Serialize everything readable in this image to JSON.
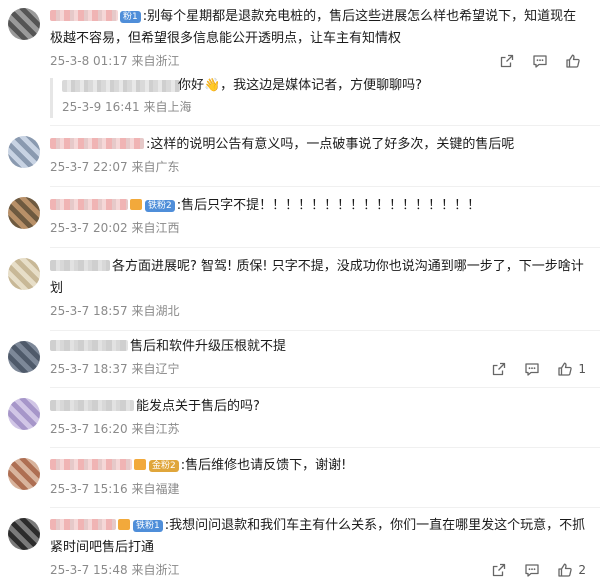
{
  "comments": [
    {
      "badge": "粉1",
      "text": ":别每个星期都是退款充电桩的，售后这些进展怎么样也希望说下，知道现在极越不容易，但希望很多信息能公开透明点，让车主有知情权",
      "date": "25-3-8 01:17",
      "location": "来自浙江",
      "likes": "",
      "reply": {
        "text": "你好👋，我这边是媒体记者，方便聊聊吗?",
        "date": "25-3-9 16:41",
        "location": "来自上海"
      }
    },
    {
      "badge": "",
      "text": ":这样的说明公告有意义吗，一点破事说了好多次，关键的售后呢",
      "date": "25-3-7 22:07",
      "location": "来自广东",
      "likes": ""
    },
    {
      "badge": "铁粉2",
      "text": ":售后只字不提！！！！！！！！！！！！！！！！！",
      "date": "25-3-7 20:02",
      "location": "来自江西",
      "likes": ""
    },
    {
      "badge": "",
      "text": "各方面进展呢? 智驾! 质保! 只字不提，没成功你也说沟通到哪一步了，下一步啥计划",
      "date": "25-3-7 18:57",
      "location": "来自湖北",
      "likes": ""
    },
    {
      "badge": "",
      "text": "售后和软件升级压根就不提",
      "date": "25-3-7 18:37",
      "location": "来自辽宁",
      "likes": "1"
    },
    {
      "badge": "",
      "text": "能发点关于售后的吗?",
      "date": "25-3-7 16:20",
      "location": "来自江苏",
      "likes": ""
    },
    {
      "badge": "金粉2",
      "text": ":售后维修也请反馈下，谢谢!",
      "date": "25-3-7 15:16",
      "location": "来自福建",
      "likes": ""
    },
    {
      "badge": "铁粉1",
      "text": ":我想问问退款和我们车主有什么关系，你们一直在哪里发这个玩意，不抓紧时间吧售后打通",
      "date": "25-3-7 15:48",
      "location": "来自浙江",
      "likes": "2"
    }
  ],
  "icons": {
    "share": "share-icon",
    "comment": "comment-icon",
    "like": "thumbs-up-icon"
  },
  "colors": {
    "text": "#1a1a1a",
    "meta": "#8a8a8a",
    "badge_blue": "#4f8ed9",
    "badge_gold": "#e0a63b"
  }
}
